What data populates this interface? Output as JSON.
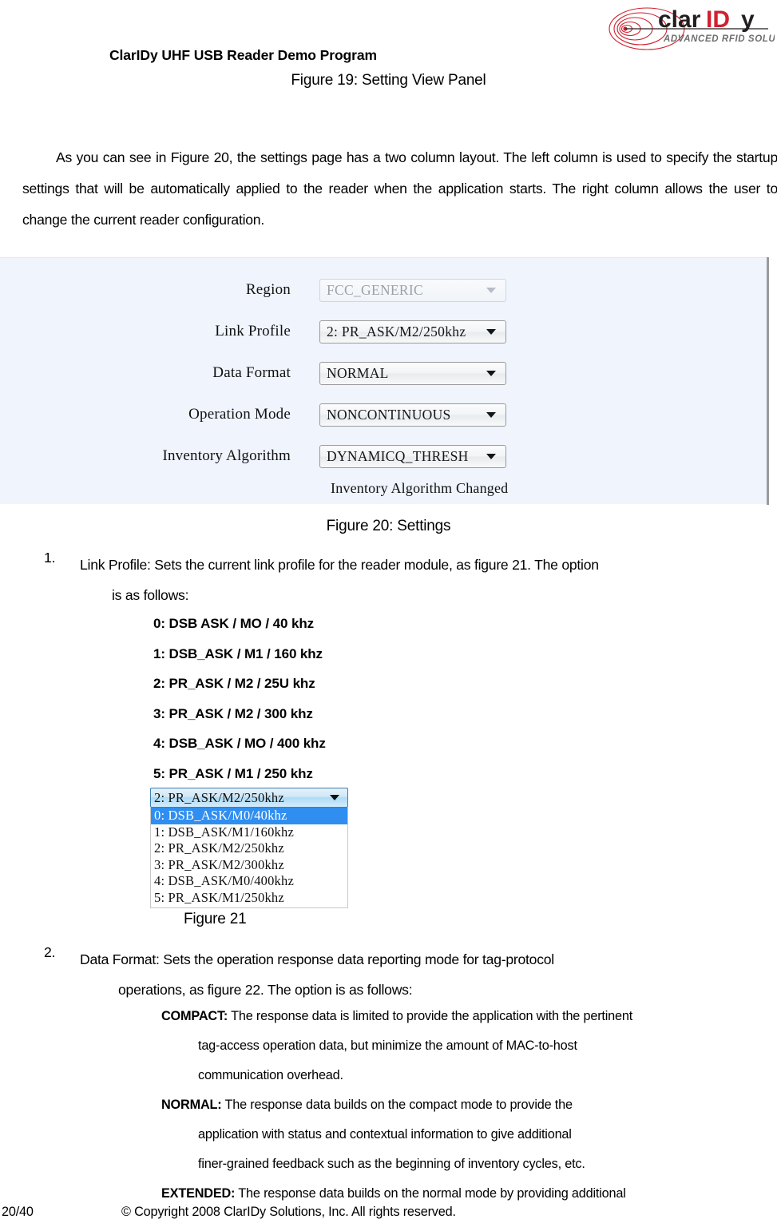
{
  "logo": {
    "wordmark_part1": "clar",
    "wordmark_part2": "ID",
    "wordmark_part3": "y",
    "tagline": "ADVANCED RFID SOLUTIONS",
    "accent_color": "#d0202f",
    "text_color": "#231f20"
  },
  "header": {
    "doc_title": "ClarIDy UHF USB Reader Demo Program",
    "figure19_caption": "Figure 19: Setting View Panel"
  },
  "intro": {
    "paragraph": "As you can see in Figure 20, the settings page has a two column layout. The left column is used to specify the startup settings that will be automatically applied to the reader when the application starts. The right column allows the user to change the current reader configuration."
  },
  "settings_panel": {
    "background_color": "#eff4fd",
    "rows": [
      {
        "label": "Region",
        "value": "FCC_GENERIC",
        "disabled": true
      },
      {
        "label": "Link Profile",
        "value": "2: PR_ASK/M2/250khz",
        "disabled": false
      },
      {
        "label": "Data Format",
        "value": "NORMAL",
        "disabled": false
      },
      {
        "label": "Operation Mode",
        "value": "NONCONTINUOUS",
        "disabled": false
      },
      {
        "label": "Inventory Algorithm",
        "value": "DYNAMICQ_THRESH",
        "disabled": false
      }
    ],
    "status_message": "Inventory Algorithm Changed",
    "caption": "Figure 20: Settings"
  },
  "list_items": {
    "item1": {
      "number": "1.",
      "line1": "Link Profile: Sets the current link profile for the reader module, as figure 21. The option",
      "line2": "is as follows:"
    },
    "item2": {
      "number": "2.",
      "line1": "Data Format: Sets the operation response data reporting mode for tag-protocol",
      "line2": "operations, as figure 22. The option is as follows:"
    }
  },
  "link_profiles": [
    "0: DSB ASK / MO / 40 khz",
    "1: DSB_ASK / M1 / 160 khz",
    "2: PR_ASK / M2 / 25U khz",
    "3: PR_ASK / M2 / 300 khz",
    "4: DSB_ASK / MO / 400 khz",
    "5: PR_ASK / M1 / 250 khz"
  ],
  "figure21": {
    "combo_value": "2: PR_ASK/M2/250khz",
    "selected_index": 0,
    "highlight_color": "#2f8ef0",
    "options": [
      "0: DSB_ASK/M0/40khz",
      "1: DSB_ASK/M1/160khz",
      "2: PR_ASK/M2/250khz",
      "3: PR_ASK/M2/300khz",
      "4: DSB_ASK/M0/400khz",
      "5: PR_ASK/M1/250khz"
    ],
    "caption": "Figure 21"
  },
  "data_format_defs": {
    "compact": {
      "term": "COMPACT:",
      "line1": " The response data is limited to provide the application with the pertinent",
      "line2": "tag-access operation data, but minimize the amount of MAC-to-host",
      "line3": "communication overhead."
    },
    "normal": {
      "term": "NORMAL:",
      "line1": " The response data builds on the compact mode to provide the",
      "line2": "application with status and contextual information to give additional",
      "line3": "finer-grained feedback such as the beginning of inventory cycles, etc."
    },
    "extended": {
      "term": "EXTENDED:",
      "line1": " The response data builds on the normal mode by providing additional"
    }
  },
  "footer": {
    "page_number": "20/40",
    "copyright": "© Copyright 2008 ClarIDy Solutions, Inc. All rights reserved."
  }
}
